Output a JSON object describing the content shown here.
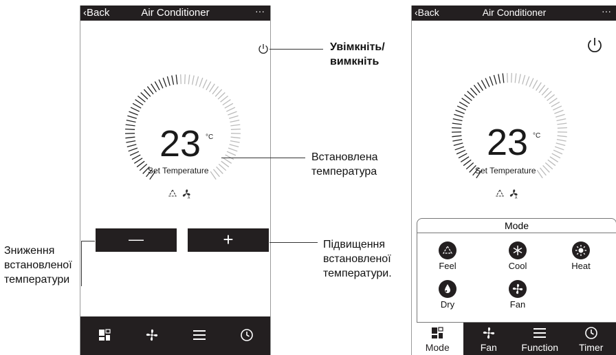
{
  "left_phone": {
    "header": {
      "back": "Back",
      "title": "Air Conditioner",
      "more": "···"
    },
    "temperature": {
      "value": "23",
      "unit": "°C",
      "label": "Set Temperature"
    },
    "buttons": {
      "minus": "—",
      "plus": "+"
    }
  },
  "right_phone": {
    "header": {
      "back": "Back",
      "title": "Air Conditioner",
      "more": "···"
    },
    "temperature": {
      "value": "23",
      "unit": "°C",
      "label": "Set Temperature"
    },
    "mode_panel": {
      "title": "Mode",
      "items": [
        {
          "label": "Feel",
          "icon": "feel-icon"
        },
        {
          "label": "Cool",
          "icon": "snowflake-icon"
        },
        {
          "label": "Heat",
          "icon": "sun-icon"
        },
        {
          "label": "Dry",
          "icon": "droplet-icon"
        },
        {
          "label": "Fan",
          "icon": "fan-icon"
        }
      ]
    },
    "footer": [
      {
        "label": "Mode",
        "icon": "mode-grid-icon",
        "active": true
      },
      {
        "label": "Fan",
        "icon": "fan-icon"
      },
      {
        "label": "Function",
        "icon": "menu-icon"
      },
      {
        "label": "Timer",
        "icon": "clock-icon"
      }
    ]
  },
  "callouts": {
    "power": "Увімкніть/\nвимкніть",
    "set_temp": "Встановлена\nтемпература",
    "decrease": "Зниження\nвстановленої\nтемператури",
    "increase": "Підвищення\nвстановленої\nтемператури."
  },
  "colors": {
    "dark": "#231f20",
    "tick_dark": "#222222",
    "tick_light": "#bbbbbb"
  }
}
